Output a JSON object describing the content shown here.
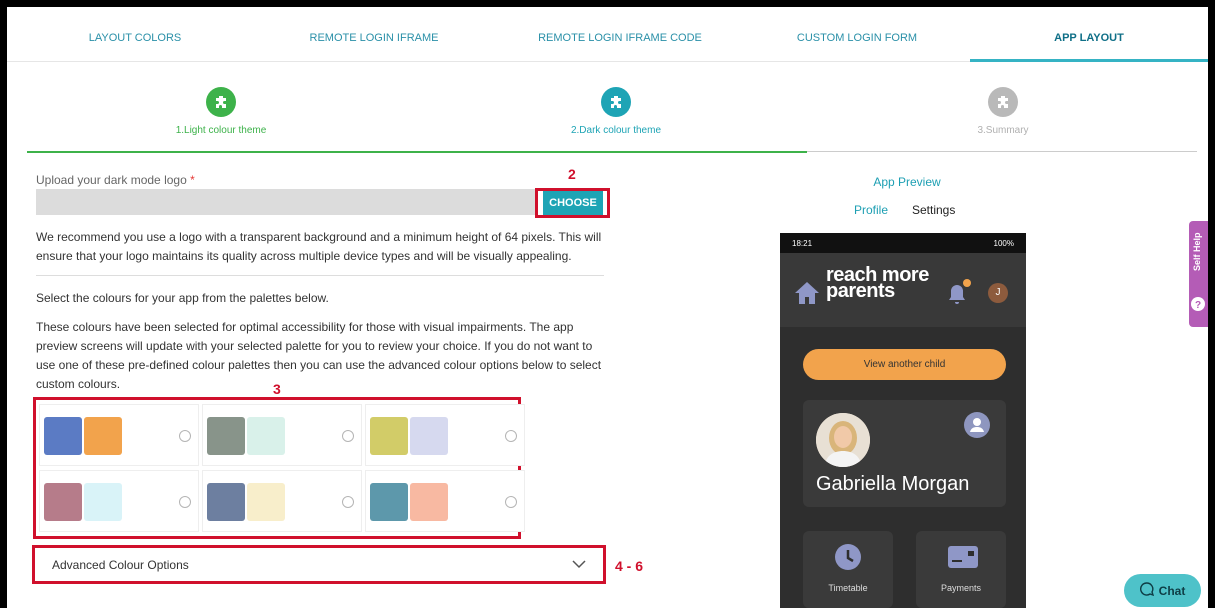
{
  "tabs": [
    {
      "label": "LAYOUT COLORS"
    },
    {
      "label": "REMOTE LOGIN IFRAME"
    },
    {
      "label": "REMOTE LOGIN IFRAME CODE"
    },
    {
      "label": "CUSTOM LOGIN FORM"
    },
    {
      "label": "APP LAYOUT",
      "active": true
    }
  ],
  "stepper": [
    {
      "label": "1.Light colour theme",
      "color": "#3db24a",
      "state": "done"
    },
    {
      "label": "2.Dark colour theme",
      "color": "#1ea4b5",
      "state": "active"
    },
    {
      "label": "3.Summary",
      "color": "#b9b9b9",
      "state": "pending"
    }
  ],
  "upload": {
    "label": "Upload your dark mode logo",
    "required_mark": "*",
    "button": "CHOOSE",
    "hint": "We recommend you use a logo with a transparent background and a minimum height of 64 pixels. This will ensure that your logo maintains its quality across multiple device types and will be visually appealing."
  },
  "palette_intro": "Select the colours for your app from the palettes below.",
  "palette_desc": "These colours have been selected for optimal accessibility for those with visual impairments. The app preview screens will update with your selected palette for you to review your choice. If you do not want to use one of these pre-defined colour palettes then you can use the advanced colour options below to select custom colours.",
  "palettes": [
    {
      "primary": "#5b7bc4",
      "secondary": "#f2a34c"
    },
    {
      "primary": "#88948a",
      "secondary": "#d9f1ea"
    },
    {
      "primary": "#d2cc68",
      "secondary": "#d6d9ef"
    },
    {
      "primary": "#b67c8a",
      "secondary": "#d9f3f8"
    },
    {
      "primary": "#6d7fa0",
      "secondary": "#f8eecb"
    },
    {
      "primary": "#5d98ab",
      "secondary": "#f8b9a2"
    }
  ],
  "advanced": {
    "label": "Advanced Colour Options"
  },
  "annotations": {
    "a2": "2",
    "a3": "3",
    "a46": "4 - 6"
  },
  "preview": {
    "title": "App Preview",
    "tabs": [
      {
        "label": "Profile"
      },
      {
        "label": "Settings"
      }
    ],
    "status_time": "18:21",
    "status_right": "100%",
    "logo_line1": "reach more",
    "logo_line2": "parents",
    "avatar_initial": "J",
    "child_button": "View another child",
    "child_name": "Gabriella Morgan",
    "tiles": [
      {
        "label": "Timetable"
      },
      {
        "label": "Payments"
      }
    ]
  },
  "self_help": "Self Help",
  "chat": "Chat",
  "colors": {
    "teal": "#1ea4b5",
    "red_annotation": "#d0102c",
    "orange": "#f2a34c",
    "purple_tab": "#b45cb6"
  }
}
